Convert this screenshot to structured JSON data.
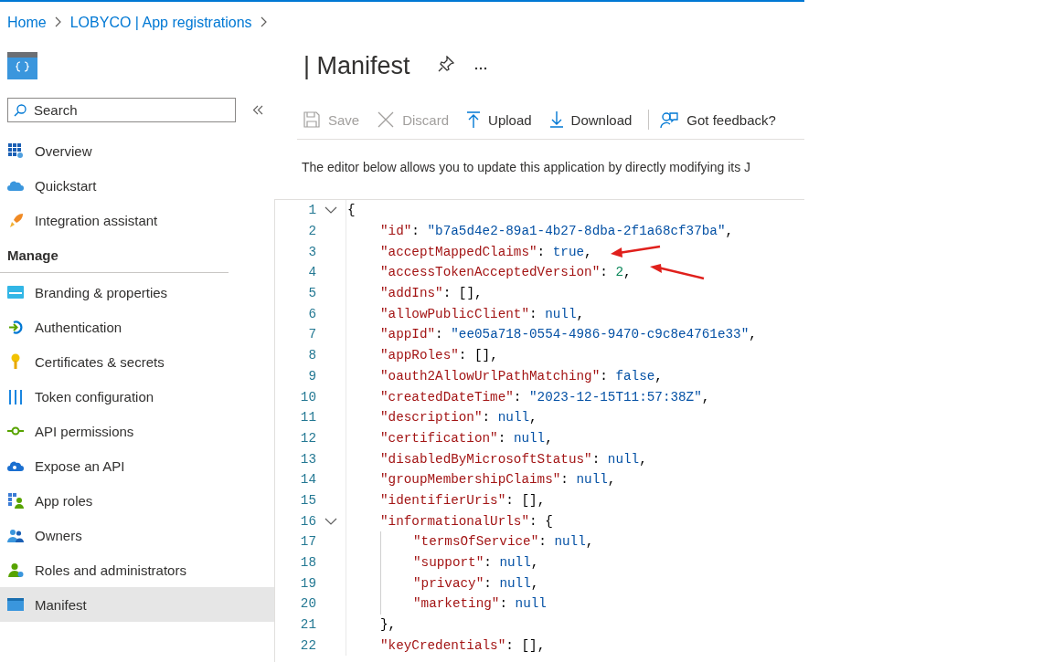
{
  "breadcrumbs": [
    {
      "label": "Home"
    },
    {
      "label": "LOBYCO | App registrations"
    }
  ],
  "page_title": "| Manifest",
  "sidebar": {
    "search": {
      "placeholder": "Search"
    },
    "items": [
      {
        "label": "Overview",
        "selected": false
      },
      {
        "label": "Quickstart",
        "selected": false
      },
      {
        "label": "Integration assistant",
        "selected": false
      },
      {
        "kind": "heading",
        "label": "Manage"
      },
      {
        "label": "Branding & properties",
        "selected": false
      },
      {
        "label": "Authentication",
        "selected": false
      },
      {
        "label": "Certificates & secrets",
        "selected": false
      },
      {
        "label": "Token configuration",
        "selected": false
      },
      {
        "label": "API permissions",
        "selected": false
      },
      {
        "label": "Expose an API",
        "selected": false
      },
      {
        "label": "App roles",
        "selected": false
      },
      {
        "label": "Owners",
        "selected": false
      },
      {
        "label": "Roles and administrators",
        "selected": false
      },
      {
        "label": "Manifest",
        "selected": true
      }
    ]
  },
  "toolbar": [
    {
      "label": "Save",
      "disabled": true
    },
    {
      "label": "Discard",
      "disabled": true
    },
    {
      "label": "Upload",
      "disabled": false
    },
    {
      "label": "Download",
      "disabled": false
    },
    {
      "label": "Got feedback?",
      "disabled": false
    }
  ],
  "intro": "The editor below allows you to update this application by directly modifying its J",
  "editor": {
    "lines": [
      {
        "number": "1",
        "open": "{",
        "expanded": true,
        "children": [
          {
            "number": "2",
            "key": "\"id\"",
            "sep": ": ",
            "value": "\"b7a5d4e2-89a1-4b27-8dba-2f1a68cf37ba\"",
            "kind": "string",
            "end": ",",
            "arrow": false
          },
          {
            "number": "3",
            "key": "\"acceptMappedClaims\"",
            "sep": ": ",
            "value": "true",
            "kind": "literal",
            "end": ",",
            "arrow": true
          },
          {
            "number": "4",
            "key": "\"accessTokenAcceptedVersion\"",
            "sep": ": ",
            "value": "2",
            "kind": "number",
            "end": ",",
            "arrow": true
          },
          {
            "number": "5",
            "key": "\"addIns\"",
            "sep": ": ",
            "value": "[]",
            "kind": "punct",
            "end": ",",
            "arrow": false
          },
          {
            "number": "6",
            "key": "\"allowPublicClient\"",
            "sep": ": ",
            "value": "null",
            "kind": "literal",
            "end": ",",
            "arrow": false
          },
          {
            "number": "7",
            "key": "\"appId\"",
            "sep": ": ",
            "value": "\"ee05a718-0554-4986-9470-c9c8e4761e33\"",
            "kind": "string",
            "end": ",",
            "arrow": false
          },
          {
            "number": "8",
            "key": "\"appRoles\"",
            "sep": ": ",
            "value": "[]",
            "kind": "punct",
            "end": ",",
            "arrow": false
          },
          {
            "number": "9",
            "key": "\"oauth2AllowUrlPathMatching\"",
            "sep": ": ",
            "value": "false",
            "kind": "literal",
            "end": ",",
            "arrow": false
          },
          {
            "number": "10",
            "key": "\"createdDateTime\"",
            "sep": ": ",
            "value": "\"2023-12-15T11:57:38Z\"",
            "kind": "string",
            "end": ",",
            "arrow": false
          },
          {
            "number": "11",
            "key": "\"description\"",
            "sep": ": ",
            "value": "null",
            "kind": "literal",
            "end": ",",
            "arrow": false
          },
          {
            "number": "12",
            "key": "\"certification\"",
            "sep": ": ",
            "value": "null",
            "kind": "literal",
            "end": ",",
            "arrow": false
          },
          {
            "number": "13",
            "key": "\"disabledByMicrosoftStatus\"",
            "sep": ": ",
            "value": "null",
            "kind": "literal",
            "end": ",",
            "arrow": false
          },
          {
            "number": "14",
            "key": "\"groupMembershipClaims\"",
            "sep": ": ",
            "value": "null",
            "kind": "literal",
            "end": ",",
            "arrow": false
          },
          {
            "number": "15",
            "key": "\"identifierUris\"",
            "sep": ": ",
            "value": "[]",
            "kind": "punct",
            "end": ",",
            "arrow": false
          },
          {
            "number": "16",
            "key": "\"informationalUrls\"",
            "sep": ": ",
            "open": "{",
            "expanded": true,
            "children": [
              {
                "number": "17",
                "key": "\"termsOfService\"",
                "sep": ": ",
                "value": "null",
                "kind": "literal",
                "end": ",",
                "arrow": false
              },
              {
                "number": "18",
                "key": "\"support\"",
                "sep": ": ",
                "value": "null",
                "kind": "literal",
                "end": ",",
                "arrow": false
              },
              {
                "number": "19",
                "key": "\"privacy\"",
                "sep": ": ",
                "value": "null",
                "kind": "literal",
                "end": ",",
                "arrow": false
              },
              {
                "number": "20",
                "key": "\"marketing\"",
                "sep": ": ",
                "value": "null",
                "kind": "literal",
                "arrow": false
              }
            ]
          },
          {
            "number": "21",
            "close": "},"
          },
          {
            "number": "22",
            "key": "\"keyCredentials\"",
            "sep": ": ",
            "value": "[]",
            "kind": "punct",
            "end": ",",
            "arrow": false
          }
        ]
      }
    ]
  }
}
